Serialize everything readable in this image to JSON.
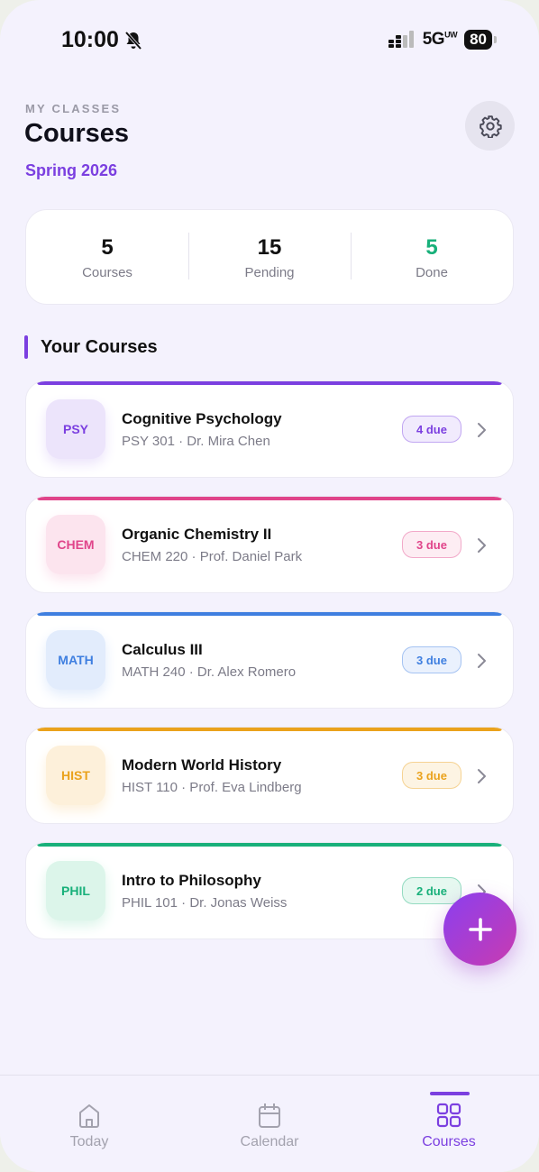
{
  "status_bar": {
    "time": "10:00",
    "network": "5G",
    "network_sup": "UW",
    "battery": "80"
  },
  "header": {
    "eyebrow": "MY CLASSES",
    "title": "Courses",
    "term": "Spring 2026"
  },
  "stats": [
    {
      "value": "5",
      "label": "Courses"
    },
    {
      "value": "15",
      "label": "Pending"
    },
    {
      "value": "5",
      "label": "Done"
    }
  ],
  "section_title": "Your Courses",
  "courses": [
    {
      "code": "PSY",
      "name": "Cognitive Psychology",
      "meta": "PSY 301 · Dr. Mira Chen",
      "due": "4 due",
      "color": "#7b3fe0",
      "tint": "#ece4fb",
      "due_bg": "#f1ebfd"
    },
    {
      "code": "CHEM",
      "name": "Organic Chemistry II",
      "meta": "CHEM 220 · Prof. Daniel Park",
      "due": "3 due",
      "color": "#e0448a",
      "tint": "#fce4ee",
      "due_bg": "#fdedf3"
    },
    {
      "code": "MATH",
      "name": "Calculus III",
      "meta": "MATH 240 · Dr. Alex Romero",
      "due": "3 due",
      "color": "#3f7fe0",
      "tint": "#e2ecfc",
      "due_bg": "#eaf1fd"
    },
    {
      "code": "HIST",
      "name": "Modern World History",
      "meta": "HIST 110 · Prof. Eva Lindberg",
      "due": "3 due",
      "color": "#eaa21c",
      "tint": "#fdf0da",
      "due_bg": "#fdf4e3"
    },
    {
      "code": "PHIL",
      "name": "Intro to Philosophy",
      "meta": "PHIL 101 · Dr. Jonas Weiss",
      "due": "2 due",
      "color": "#18b07a",
      "tint": "#dcf5ea",
      "due_bg": "#e6f8f0"
    }
  ],
  "tabs": [
    {
      "label": "Today",
      "icon": "home-icon"
    },
    {
      "label": "Calendar",
      "icon": "calendar-icon"
    },
    {
      "label": "Courses",
      "icon": "grid-icon",
      "active": true
    }
  ]
}
